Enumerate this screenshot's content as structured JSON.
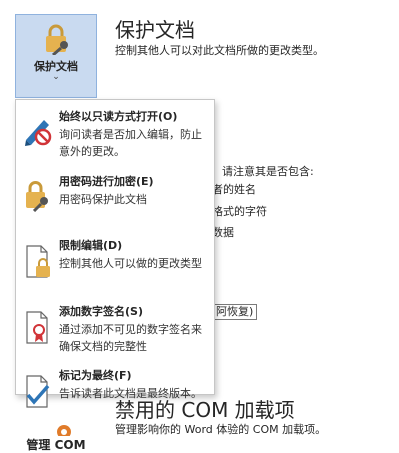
{
  "protect": {
    "button_label": "保护文档",
    "chevron": "⌄",
    "title": "保护文档",
    "subtitle": "控制其他人可以对此文档所做的更改类型。"
  },
  "background": {
    "note": "请注意其是否包含:",
    "line1": "者的姓名",
    "line2": "格式的字符",
    "line3": "数据",
    "restore": "阿恢复)"
  },
  "menu": {
    "items": [
      {
        "title": "始终以只读方式打开(O)",
        "desc": "询问读者是否加入编辑，防止意外的更改。",
        "icon": "pencil-no-icon"
      },
      {
        "title": "用密码进行加密(E)",
        "desc": "用密码保护此文档",
        "icon": "lock-key-icon"
      },
      {
        "title": "限制编辑(D)",
        "desc": "控制其他人可以做的更改类型",
        "icon": "doc-lock-icon"
      },
      {
        "title": "添加数字签名(S)",
        "desc": "通过添加不可见的数字签名来确保文档的完整性",
        "icon": "doc-ribbon-icon"
      },
      {
        "title": "标记为最终(F)",
        "desc": "告诉读者此文档是最终版本。",
        "icon": "doc-check-icon"
      }
    ]
  },
  "com": {
    "title": "禁用的 COM 加载项",
    "subtitle": "管理影响你的 Word 体验的 COM 加载项。",
    "button_label": "管理 COM"
  },
  "colors": {
    "tile_bg": "#c9daf0",
    "lock_gold": "#d9a441",
    "accent_blue": "#2e75b6",
    "red": "#d13438"
  }
}
